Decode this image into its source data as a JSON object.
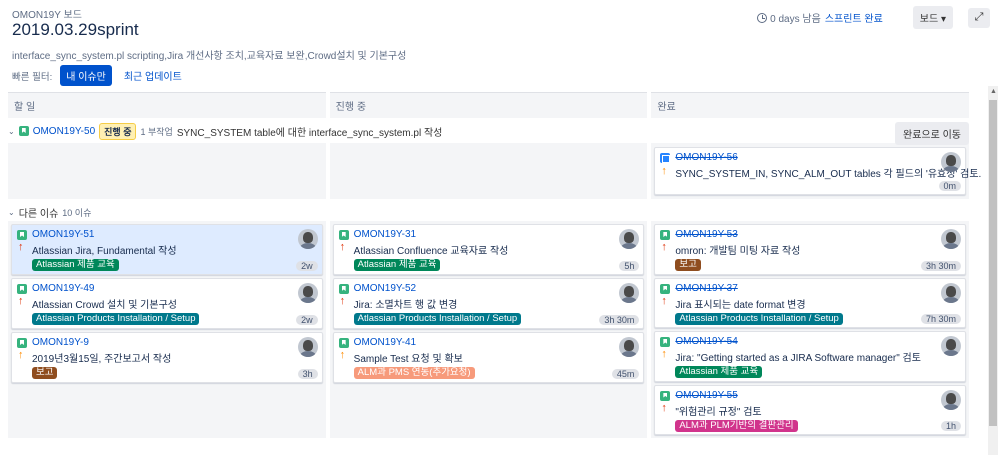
{
  "header": {
    "board_name": "OMON19Y 보드",
    "sprint_title": "2019.03.29sprint",
    "sprint_goal": "interface_sync_system.pl scripting,Jira 개선사항 조치,교육자료 보완,Crowd설치 및 기본구성",
    "quick_filters_label": "빠른 필터:",
    "filter_mine": "내 이슈만",
    "filter_recent": "최근 업데이트",
    "days_left": "0 days 남음",
    "complete_sprint": "스프린트 완료",
    "board_button": "보드 ▾",
    "expand_icon": "expand-icon"
  },
  "columns": [
    "할 일",
    "진행 중",
    "완료"
  ],
  "swimlane1": {
    "key": "OMON19Y-50",
    "status": "진행 중",
    "subtasks": "1 부작업",
    "summary": "SYNC_SYSTEM table에 대한 interface_sync_system.pl 작성",
    "move_done": "완료으로 이동",
    "done_card": {
      "key": "OMON19Y-56",
      "summary": "SYNC_SYSTEM_IN,  SYNC_ALM_OUT tables 각 필드의 '유효성' 검토.",
      "estimate": "0m",
      "priority": "med"
    }
  },
  "swimlane2": {
    "title": "다른 이슈",
    "count": "10 이슈"
  },
  "epic_colors": {
    "Atlassian 제품 교육": "#00875a",
    "Atlassian Products Installation / Setup": "#00798c",
    "보고": "#8f4d1f",
    "ALM과 PMS 연동(추가요청)": "#f79a7b",
    "ALM과 PLM기반의 결판관리": "#d1348c"
  },
  "todo": [
    {
      "key": "OMON19Y-51",
      "summary": "Atlassian Jira, Fundamental 작성",
      "epic": "Atlassian 제품 교육",
      "epic_color": "#00875a",
      "estimate": "2w",
      "priority": "high",
      "selected": true
    },
    {
      "key": "OMON19Y-49",
      "summary": "Atlassian Crowd 설치 및 기본구성",
      "epic": "Atlassian Products Installation / Setup",
      "epic_color": "#00798c",
      "estimate": "2w",
      "priority": "high",
      "selected": false
    },
    {
      "key": "OMON19Y-9",
      "summary": "2019년3월15일, 주간보고서 작성",
      "epic": "보고",
      "epic_color": "#8f4d1f",
      "estimate": "3h",
      "priority": "med",
      "selected": false
    }
  ],
  "inprogress": [
    {
      "key": "OMON19Y-31",
      "summary": "Atlassian Confluence 교육자료 작성",
      "epic": "Atlassian 제품 교육",
      "epic_color": "#00875a",
      "estimate": "5h",
      "priority": "high"
    },
    {
      "key": "OMON19Y-52",
      "summary": "Jira: 소멸차트 행 값 변경",
      "epic": "Atlassian Products Installation / Setup",
      "epic_color": "#00798c",
      "estimate": "3h 30m",
      "priority": "high"
    },
    {
      "key": "OMON19Y-41",
      "summary": "Sample Test 요청 및 확보",
      "epic": "ALM과 PMS 연동(추가요청)",
      "epic_color": "#f79a7b",
      "estimate": "45m",
      "priority": "med"
    }
  ],
  "done": [
    {
      "key": "OMON19Y-53",
      "summary": "omron: 개발팀 미팅 자료 작성",
      "epic": "보고",
      "epic_color": "#8f4d1f",
      "estimate": "3h 30m",
      "priority": "high"
    },
    {
      "key": "OMON19Y-37",
      "summary": "Jira 표시되는 date format 변경",
      "epic": "Atlassian Products Installation / Setup",
      "epic_color": "#00798c",
      "estimate": "7h 30m",
      "priority": "high"
    },
    {
      "key": "OMON19Y-54",
      "summary": "Jira: \"Getting started as a JIRA Software manager\" 검토",
      "epic": "Atlassian 제품 교육",
      "epic_color": "#00875a",
      "estimate": "",
      "priority": "med"
    },
    {
      "key": "OMON19Y-55",
      "summary": "\"위험관리 규정\" 검토",
      "epic": "ALM과 PLM기반의 결판관리",
      "epic_color": "#d1348c",
      "estimate": "1h",
      "priority": "high"
    }
  ]
}
